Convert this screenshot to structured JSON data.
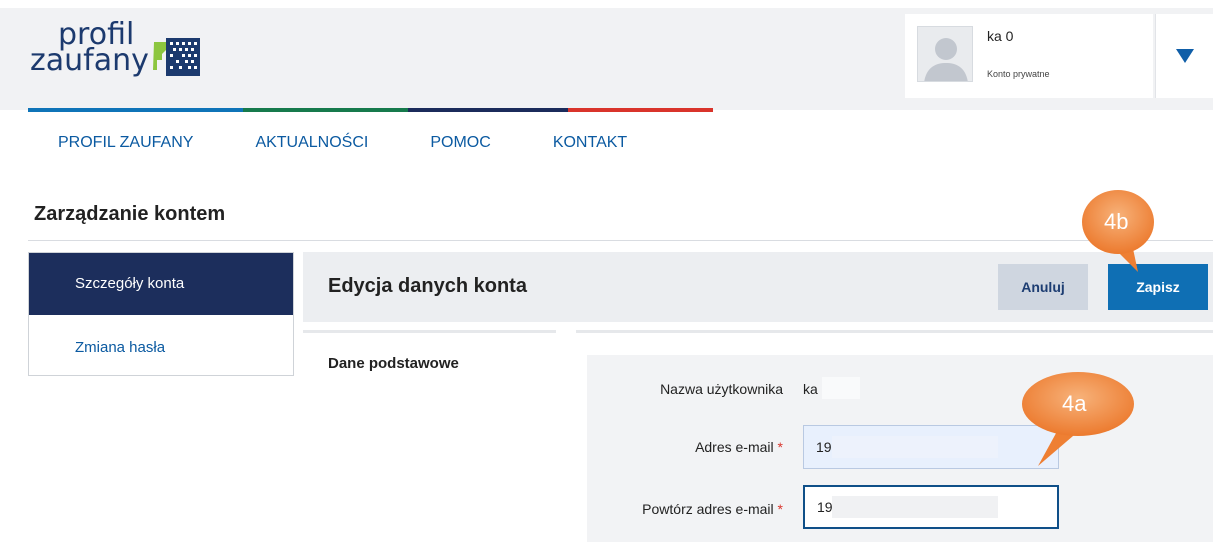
{
  "header": {
    "logo": {
      "line1": "profil",
      "line2": "zaufany"
    },
    "user": {
      "name": "ka      0",
      "account_type": "Konto prywatne"
    }
  },
  "nav": {
    "items": [
      "PROFIL ZAUFANY",
      "AKTUALNOŚCI",
      "POMOC",
      "KONTAKT"
    ]
  },
  "page": {
    "title": "Zarządzanie kontem"
  },
  "sidebar": {
    "items": [
      {
        "label": "Szczegóły konta",
        "active": true
      },
      {
        "label": "Zmiana hasła",
        "active": false
      }
    ]
  },
  "panel": {
    "title": "Edycja danych konta",
    "cancel_label": "Anuluj",
    "save_label": "Zapisz",
    "section_title": "Dane podstawowe"
  },
  "form": {
    "username_label": "Nazwa użytkownika",
    "username_value": "ka",
    "email_label": "Adres e-mail",
    "email_value": "19",
    "email_repeat_label": "Powtórz adres e-mail",
    "email_repeat_value": "19",
    "required_marker": "*"
  },
  "callouts": {
    "save": "4b",
    "email": "4a"
  },
  "colors": {
    "primary": "#0f6fb4",
    "sidebar_active": "#1c2e5c",
    "callout": "#f0883a",
    "required": "#d9342b"
  },
  "icons": {
    "avatar": "user-silhouette-icon",
    "menu": "triangle-down-icon"
  }
}
